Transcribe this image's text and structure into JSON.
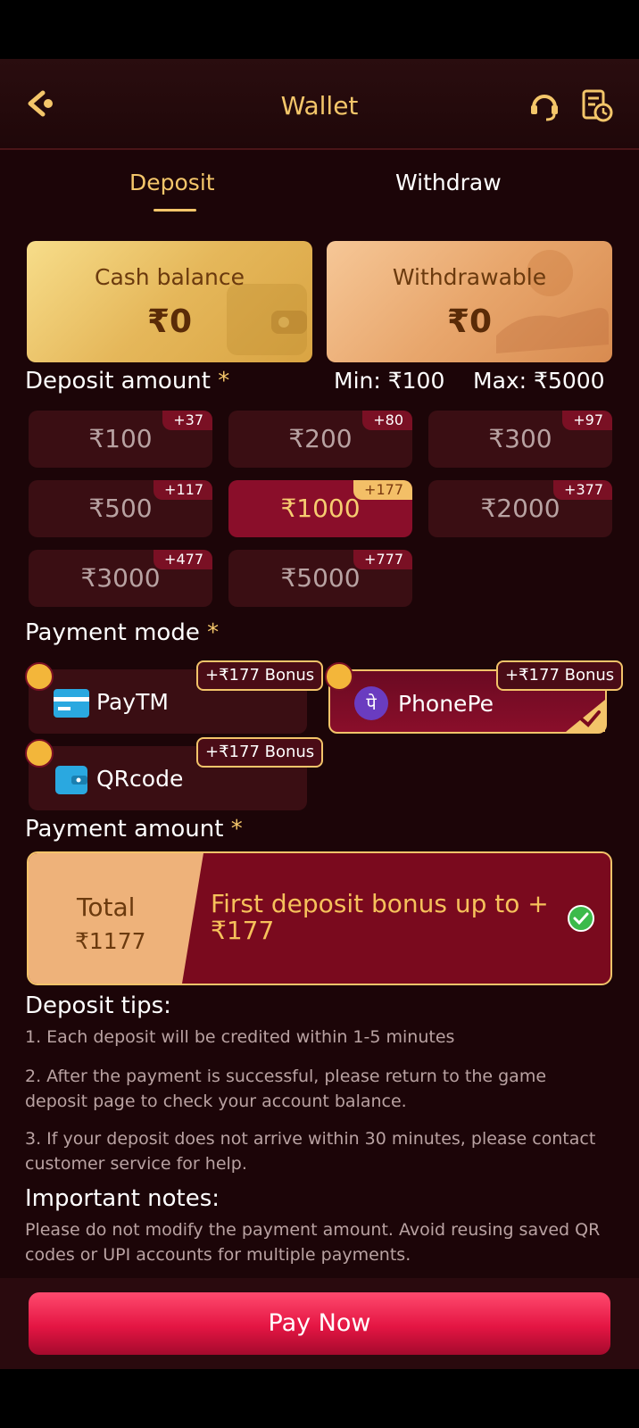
{
  "header": {
    "title": "Wallet"
  },
  "tabs": {
    "deposit": "Deposit",
    "withdraw": "Withdraw"
  },
  "balances": {
    "cash_label": "Cash balance",
    "cash_value": "₹0",
    "withdrawable_label": "Withdrawable",
    "withdrawable_value": "₹0"
  },
  "deposit": {
    "label": "Deposit amount",
    "min": "Min: ₹100",
    "max": "Max: ₹5000",
    "amounts": [
      {
        "value": "₹100",
        "bonus": "+37"
      },
      {
        "value": "₹200",
        "bonus": "+80"
      },
      {
        "value": "₹300",
        "bonus": "+97"
      },
      {
        "value": "₹500",
        "bonus": "+117"
      },
      {
        "value": "₹1000",
        "bonus": "+177"
      },
      {
        "value": "₹2000",
        "bonus": "+377"
      },
      {
        "value": "₹3000",
        "bonus": "+477"
      },
      {
        "value": "₹5000",
        "bonus": "+777"
      }
    ],
    "selected_amount": "₹1000"
  },
  "payment_mode": {
    "label": "Payment mode",
    "modes": [
      {
        "name": "PayTM",
        "bonus": "+₹177 Bonus"
      },
      {
        "name": "PhonePe",
        "bonus": "+₹177 Bonus"
      },
      {
        "name": "QRcode",
        "bonus": "+₹177 Bonus"
      }
    ],
    "selected_mode": "PhonePe"
  },
  "payment_amount": {
    "label": "Payment amount",
    "total_label": "Total",
    "total_value": "₹1177",
    "bonus_text": "First deposit bonus up to +₹177"
  },
  "tips": {
    "title": "Deposit tips:",
    "items": [
      "1. Each deposit will be credited within 1-5 minutes",
      "2. After the payment is successful, please return to the game deposit page to check your account balance.",
      "3. If your deposit does not arrive within 30 minutes, please contact customer service for help."
    ]
  },
  "notes": {
    "title": "Important notes:",
    "text": "Please do not modify the payment amount. Avoid reusing saved QR codes or UPI accounts for multiple payments."
  },
  "actions": {
    "pay_now": "Pay Now"
  },
  "colors": {
    "gold": "#f4c66a",
    "background": "#1c0508",
    "selected": "#8a0e2a",
    "pay_button": "#e41543"
  }
}
